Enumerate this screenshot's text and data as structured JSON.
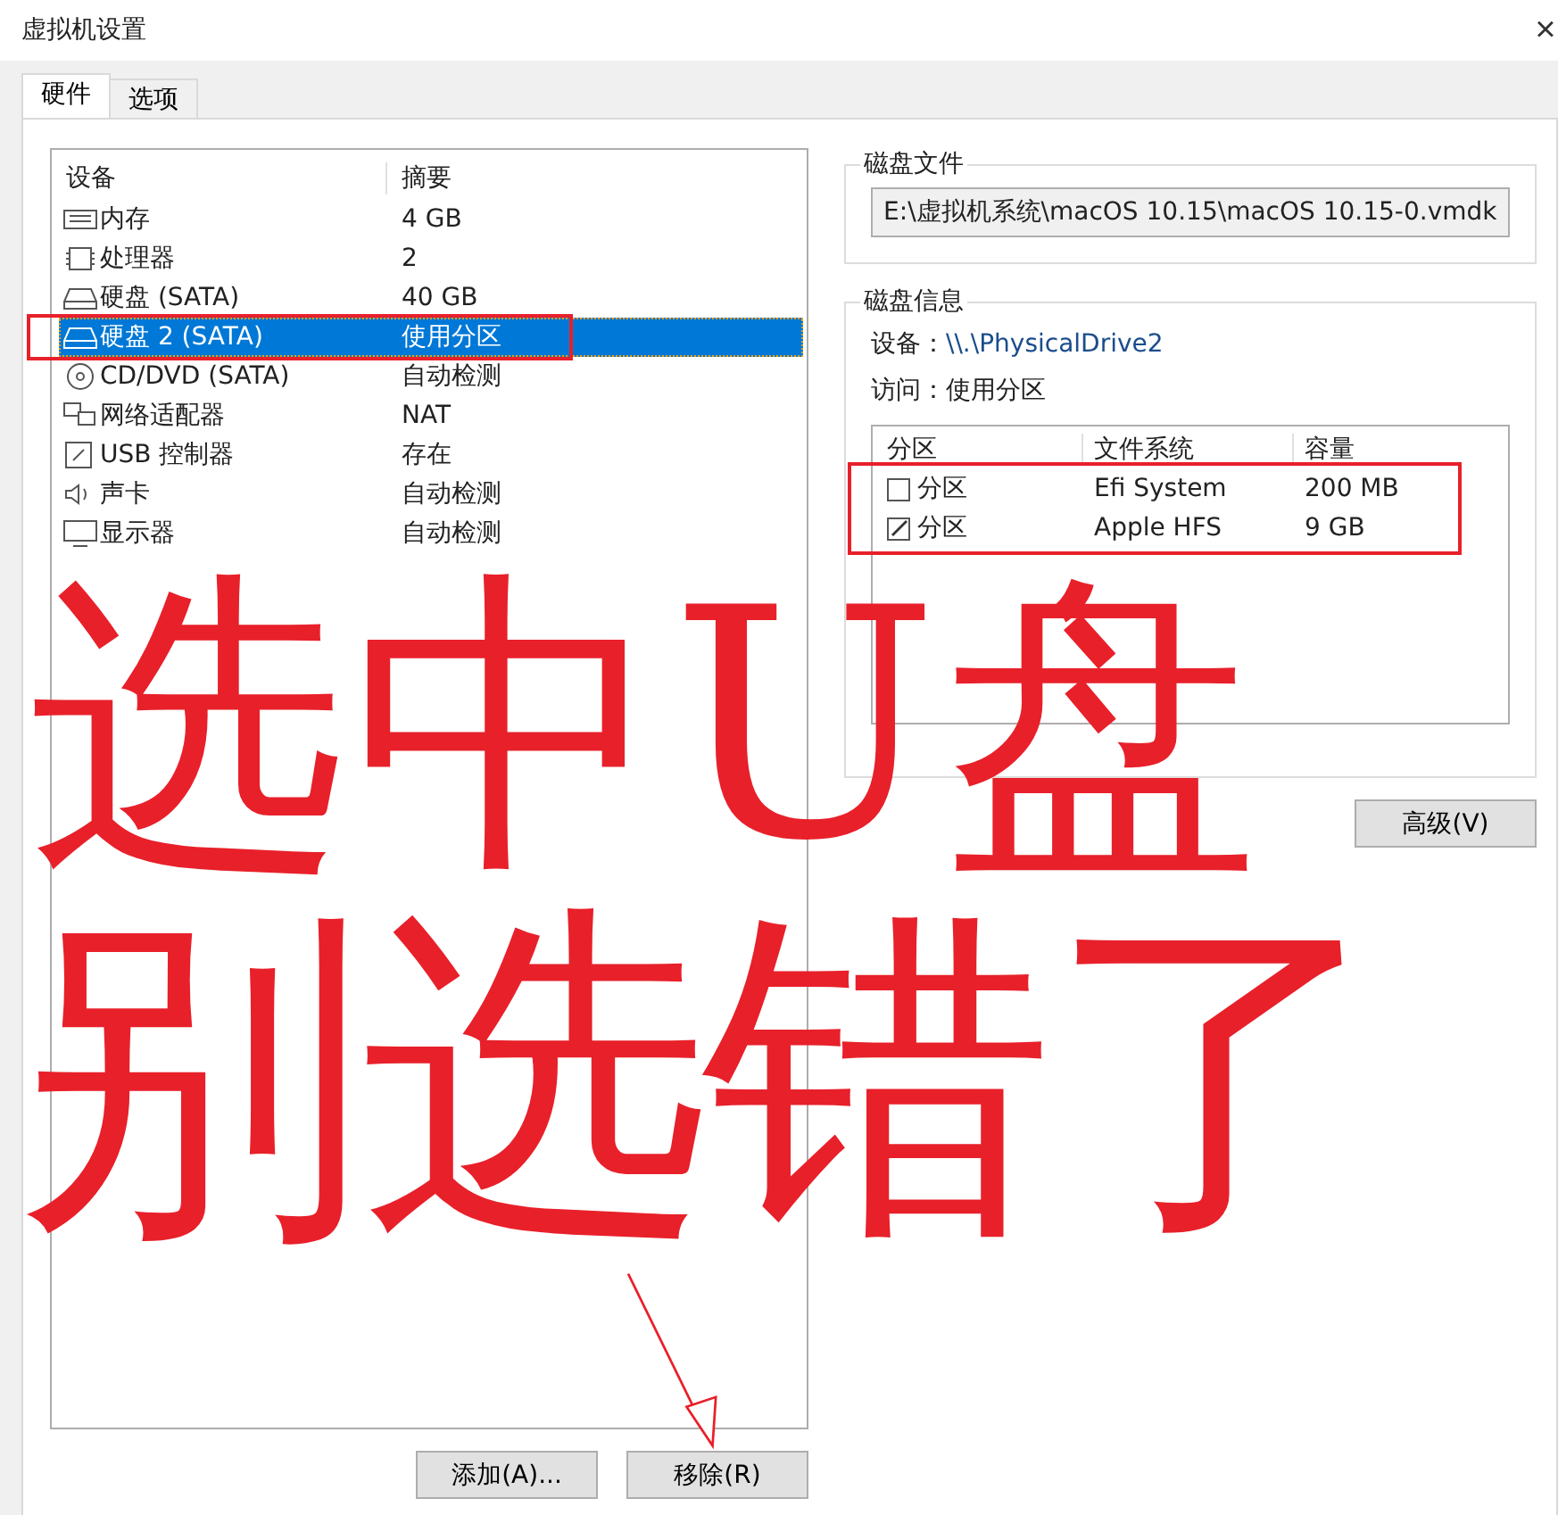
{
  "window": {
    "title": "虚拟机设置",
    "close": "×"
  },
  "tabs": [
    {
      "label": "硬件",
      "selected": true
    },
    {
      "label": "选项",
      "selected": false
    }
  ],
  "devices": {
    "columns": [
      "设备",
      "摘要"
    ],
    "rows": [
      {
        "kind": "memory",
        "name": "内存",
        "summary": "4 GB",
        "selected": false
      },
      {
        "kind": "cpu",
        "name": "处理器",
        "summary": "2",
        "selected": false
      },
      {
        "kind": "disk",
        "name": "硬盘 (SATA)",
        "summary": "40 GB",
        "selected": false
      },
      {
        "kind": "disk",
        "name": "硬盘 2 (SATA)",
        "summary": "使用分区",
        "selected": true
      },
      {
        "kind": "cdrom",
        "name": "CD/DVD (SATA)",
        "summary": "自动检测",
        "selected": false
      },
      {
        "kind": "network",
        "name": "网络适配器",
        "summary": "NAT",
        "selected": false
      },
      {
        "kind": "usb",
        "name": "USB 控制器",
        "summary": "存在",
        "selected": false
      },
      {
        "kind": "sound",
        "name": "声卡",
        "summary": "自动检测",
        "selected": false
      },
      {
        "kind": "display",
        "name": "显示器",
        "summary": "自动检测",
        "selected": false
      }
    ]
  },
  "buttons": [
    {
      "label": "添加(A)..."
    },
    {
      "label": "移除(R)"
    }
  ],
  "disk_file": {
    "title": "磁盘文件",
    "value": "E:\\虚拟机系统\\macOS 10.15\\macOS 10.15-0.vmdk"
  },
  "disk_info": {
    "title": "磁盘信息",
    "device_label": "设备：",
    "device": "\\\\.\\PhysicalDrive2",
    "access_label": "访问：",
    "access": "使用分区",
    "columns": [
      "分区",
      "文件系统",
      "容量"
    ],
    "partitions": [
      {
        "name": "分区",
        "checked": false,
        "file_system": "Efi System",
        "capacity": "200 MB"
      },
      {
        "name": "分区",
        "checked": true,
        "file_system": "Apple HFS",
        "capacity": "9 GB"
      }
    ]
  },
  "advanced_button": "高级(V)",
  "annotation": {
    "lines": [
      "选中U盘",
      "别选错了"
    ]
  }
}
